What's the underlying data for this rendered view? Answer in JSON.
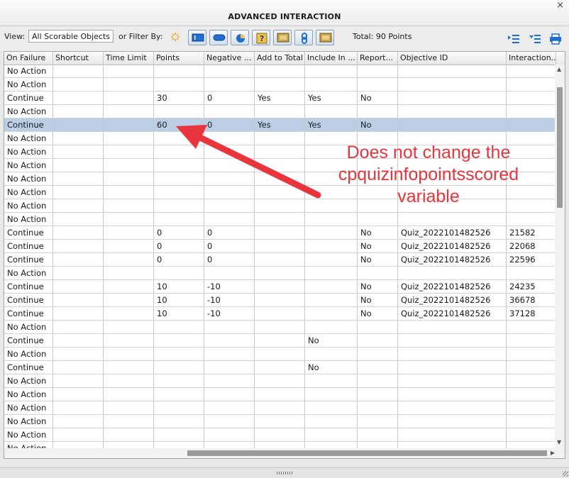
{
  "window": {
    "title": "ADVANCED INTERACTION",
    "close_glyph": "×"
  },
  "toolbar": {
    "view_label": "View:",
    "view_value": "All Scorable Objects",
    "filter_label": "or Filter By:",
    "total_text": "Total: 90 Points",
    "filter_icons": [
      "text-entry-icon",
      "button-icon",
      "drag-drop-icon",
      "question-icon",
      "widget-icon",
      "link-icon",
      "interaction-icon"
    ],
    "right_icons": [
      "collapse-list-icon",
      "expand-list-icon",
      "print-icon"
    ]
  },
  "grid": {
    "columns": [
      "On Failure",
      "Shortcut",
      "Time Limit",
      "Points",
      "Negative ...",
      "Add to Total",
      "Include In ...",
      "Report...",
      "Objective ID",
      "Interaction..."
    ],
    "rows": [
      [
        "No Action",
        "",
        "",
        "",
        "",
        "",
        "",
        "",
        "",
        ""
      ],
      [
        "No Action",
        "",
        "",
        "",
        "",
        "",
        "",
        "",
        "",
        ""
      ],
      [
        "Continue",
        "",
        "",
        "30",
        "0",
        "Yes",
        "Yes",
        "No",
        "",
        ""
      ],
      [
        "No Action",
        "",
        "",
        "",
        "",
        "",
        "",
        "",
        "",
        ""
      ],
      [
        "Continue",
        "",
        "",
        "60",
        "0",
        "Yes",
        "Yes",
        "No",
        "",
        ""
      ],
      [
        "No Action",
        "",
        "",
        "",
        "",
        "",
        "",
        "",
        "",
        ""
      ],
      [
        "No Action",
        "",
        "",
        "",
        "",
        "",
        "",
        "",
        "",
        ""
      ],
      [
        "No Action",
        "",
        "",
        "",
        "",
        "",
        "",
        "",
        "",
        ""
      ],
      [
        "No Action",
        "",
        "",
        "",
        "",
        "",
        "",
        "",
        "",
        ""
      ],
      [
        "No Action",
        "",
        "",
        "",
        "",
        "",
        "",
        "",
        "",
        ""
      ],
      [
        "No Action",
        "",
        "",
        "",
        "",
        "",
        "",
        "",
        "",
        ""
      ],
      [
        "No Action",
        "",
        "",
        "",
        "",
        "",
        "",
        "",
        "",
        ""
      ],
      [
        "Continue",
        "",
        "",
        "0",
        "0",
        "",
        "",
        "No",
        "Quiz_2022101482526",
        "21582"
      ],
      [
        "Continue",
        "",
        "",
        "0",
        "0",
        "",
        "",
        "No",
        "Quiz_2022101482526",
        "22068"
      ],
      [
        "Continue",
        "",
        "",
        "0",
        "0",
        "",
        "",
        "No",
        "Quiz_2022101482526",
        "22596"
      ],
      [
        "No Action",
        "",
        "",
        "",
        "",
        "",
        "",
        "",
        "",
        ""
      ],
      [
        "Continue",
        "",
        "",
        "10",
        "-10",
        "",
        "",
        "No",
        "Quiz_2022101482526",
        "24235"
      ],
      [
        "Continue",
        "",
        "",
        "10",
        "-10",
        "",
        "",
        "No",
        "Quiz_2022101482526",
        "36678"
      ],
      [
        "Continue",
        "",
        "",
        "10",
        "-10",
        "",
        "",
        "No",
        "Quiz_2022101482526",
        "37128"
      ],
      [
        "No Action",
        "",
        "",
        "",
        "",
        "",
        "",
        "",
        "",
        ""
      ],
      [
        "Continue",
        "",
        "",
        "",
        "",
        "",
        "No",
        "",
        "",
        ""
      ],
      [
        "No Action",
        "",
        "",
        "",
        "",
        "",
        "",
        "",
        "",
        ""
      ],
      [
        "Continue",
        "",
        "",
        "",
        "",
        "",
        "No",
        "",
        "",
        ""
      ],
      [
        "No Action",
        "",
        "",
        "",
        "",
        "",
        "",
        "",
        "",
        ""
      ],
      [
        "No Action",
        "",
        "",
        "",
        "",
        "",
        "",
        "",
        "",
        ""
      ],
      [
        "No Action",
        "",
        "",
        "",
        "",
        "",
        "",
        "",
        "",
        ""
      ],
      [
        "No Action",
        "",
        "",
        "",
        "",
        "",
        "",
        "",
        "",
        ""
      ],
      [
        "No Action",
        "",
        "",
        "",
        "",
        "",
        "",
        "",
        "",
        ""
      ],
      [
        "No Action",
        "",
        "",
        "",
        "",
        "",
        "",
        "",
        "",
        ""
      ]
    ],
    "selected_row": 4
  },
  "annotation": {
    "lines": [
      "Does not change the",
      "cpquizinfopointsscored",
      "variable"
    ],
    "color": "#e8343c"
  },
  "colors": {
    "selection": "#bccde6",
    "accent": "#2a6fc9",
    "annotation": "#e8343c"
  }
}
